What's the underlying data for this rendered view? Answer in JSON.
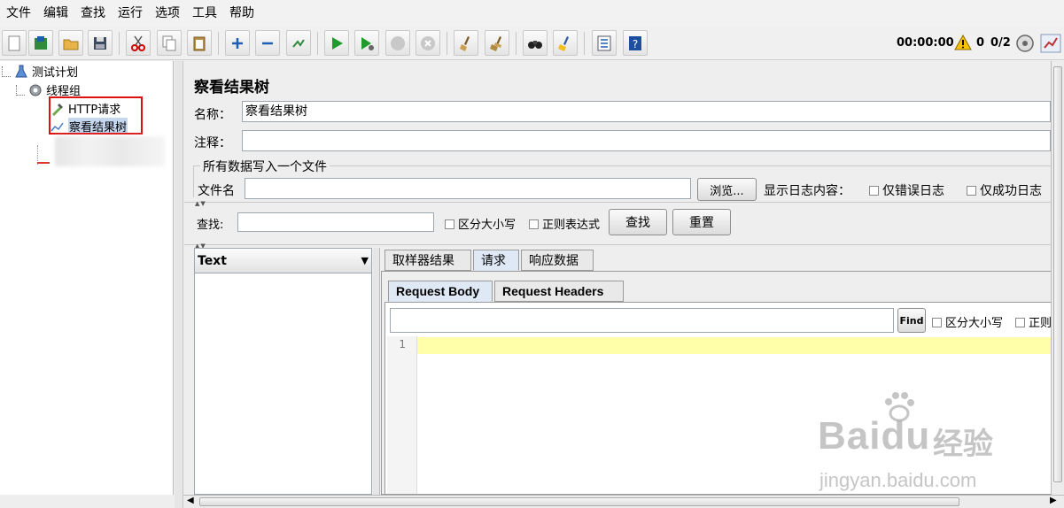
{
  "menu": [
    "文件",
    "编辑",
    "查找",
    "运行",
    "选项",
    "工具",
    "帮助"
  ],
  "toolbar": {
    "icons": [
      "new-icon",
      "template-icon",
      "open-icon",
      "save-icon",
      "cut-icon",
      "copy-icon",
      "paste-icon",
      "expand-icon",
      "collapse-icon",
      "toggle-icon",
      "start-icon",
      "start-no-pause-icon",
      "stop-icon",
      "shutdown-icon",
      "clear-icon",
      "clear-all-icon",
      "search-icon",
      "reset-search-icon",
      "function-helper-icon",
      "help-icon"
    ],
    "timer": "00:00:00",
    "warnings": "0",
    "threads": "0/2"
  },
  "tree": {
    "items": [
      {
        "label": "测试计划",
        "icon": "flask-icon"
      },
      {
        "label": "线程组",
        "icon": "gear-icon"
      },
      {
        "label": "HTTP请求",
        "icon": "pipette-icon"
      },
      {
        "label": "察看结果树",
        "icon": "chart-icon"
      }
    ]
  },
  "panel": {
    "title": "察看结果树",
    "name_label": "名称：",
    "name_value": "察看结果树",
    "comment_label": "注释：",
    "comment_value": "",
    "file_section": "所有数据写入一个文件",
    "filename_label": "文件名",
    "filename_value": "",
    "browse": "浏览...",
    "log_label": "显示日志内容：",
    "errors_only": "仅错误日志",
    "success_only": "仅成功日志"
  },
  "search": {
    "label": "查找:",
    "value": "",
    "case": "区分大小写",
    "regex": "正则表达式",
    "find": "查找",
    "reset": "重置"
  },
  "results": {
    "renderer": "Text",
    "tabs": [
      "取样器结果",
      "请求",
      "响应数据"
    ],
    "active_tab": "请求",
    "subtabs": [
      "Request Body",
      "Request Headers"
    ],
    "active_subtab": "Request Body",
    "find_button": "Find",
    "find_case": "区分大小写",
    "find_regex": "正则",
    "line_number": "1"
  },
  "watermark": {
    "brand": "Baidu",
    "suffix": "经验",
    "url": "jingyan.baidu.com"
  }
}
